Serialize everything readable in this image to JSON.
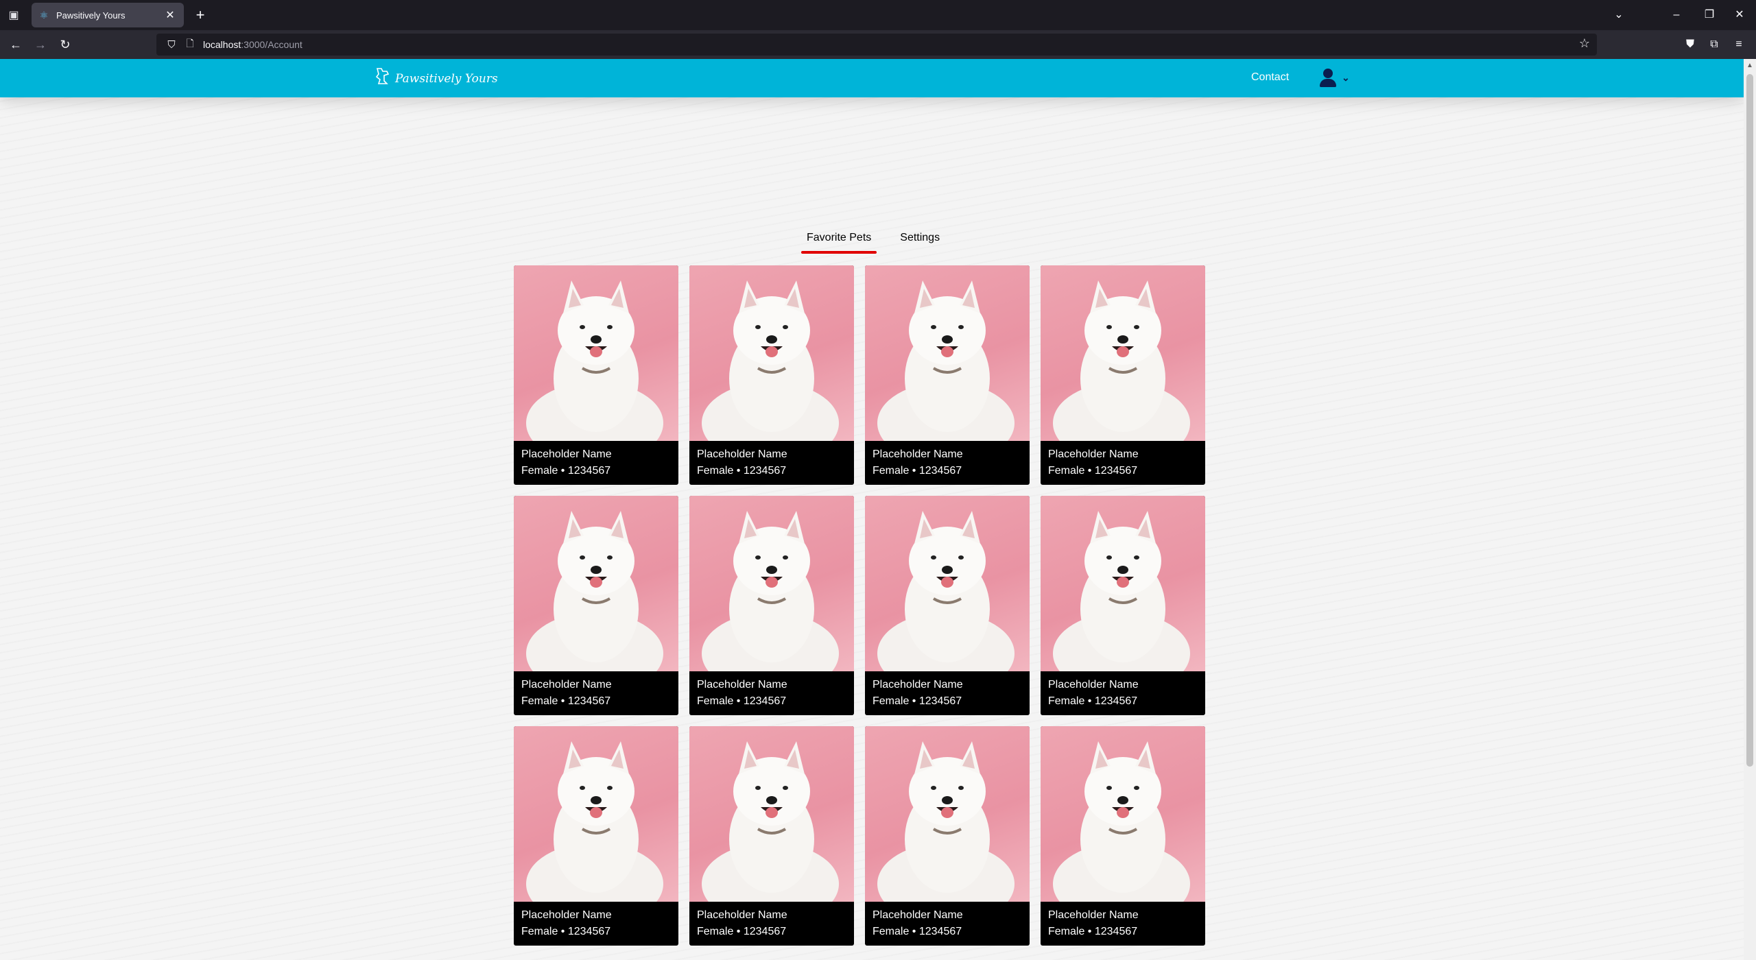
{
  "browser": {
    "tab_title": "Pawsitively Yours",
    "url_host": "localhost",
    "url_path": ":3000/Account"
  },
  "site": {
    "logo_text": "Pawsitively Yours",
    "nav_contact": "Contact",
    "accent_color": "#00b4d8",
    "tab_underline_color": "#e00000"
  },
  "tabs": [
    {
      "label": "Favorite Pets",
      "active": true
    },
    {
      "label": "Settings",
      "active": false
    }
  ],
  "pets": [
    {
      "name": "Placeholder Name",
      "details": "Female • 1234567"
    },
    {
      "name": "Placeholder Name",
      "details": "Female • 1234567"
    },
    {
      "name": "Placeholder Name",
      "details": "Female • 1234567"
    },
    {
      "name": "Placeholder Name",
      "details": "Female • 1234567"
    },
    {
      "name": "Placeholder Name",
      "details": "Female • 1234567"
    },
    {
      "name": "Placeholder Name",
      "details": "Female • 1234567"
    },
    {
      "name": "Placeholder Name",
      "details": "Female • 1234567"
    },
    {
      "name": "Placeholder Name",
      "details": "Female • 1234567"
    },
    {
      "name": "Placeholder Name",
      "details": "Female • 1234567"
    },
    {
      "name": "Placeholder Name",
      "details": "Female • 1234567"
    },
    {
      "name": "Placeholder Name",
      "details": "Female • 1234567"
    },
    {
      "name": "Placeholder Name",
      "details": "Female • 1234567"
    }
  ]
}
